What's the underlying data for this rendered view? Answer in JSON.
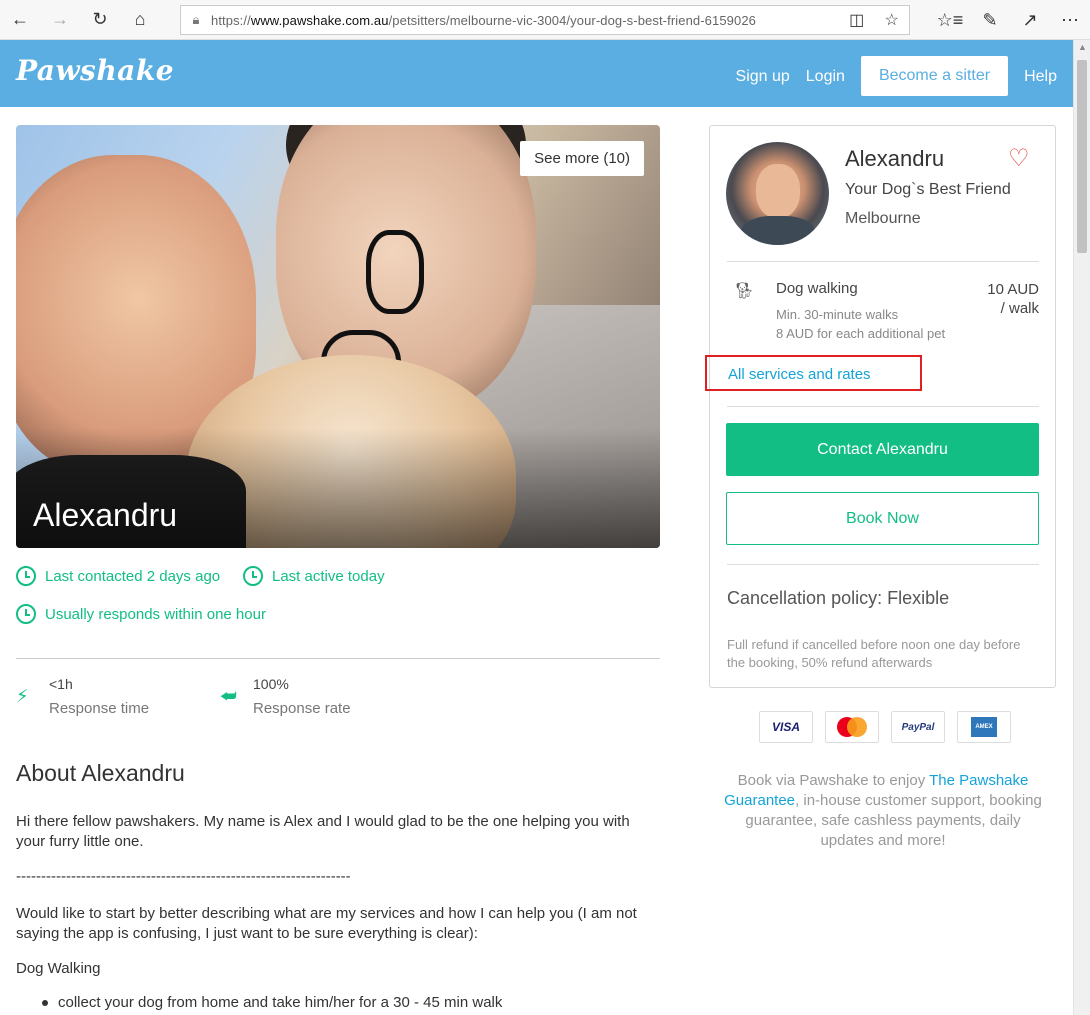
{
  "browser": {
    "url_prefix": "https://",
    "url_domain": "www.pawshake.com.au",
    "url_path": "/petsitters/melbourne-vic-3004/your-dog-s-best-friend-6159026"
  },
  "header": {
    "logo": "Pawshake",
    "signup": "Sign up",
    "login": "Login",
    "become_sitter": "Become a sitter",
    "help": "Help"
  },
  "hero": {
    "see_more": "See more (10)",
    "name": "Alexandru"
  },
  "activity": {
    "last_contacted": "Last contacted 2 days ago",
    "last_active": "Last active today",
    "responds": "Usually responds within one hour"
  },
  "stats": {
    "response_time_value": "<1h",
    "response_time_label": "Response time",
    "response_rate_value": "100%",
    "response_rate_label": "Response rate"
  },
  "about": {
    "title": "About Alexandru",
    "p1": "Hi there fellow pawshakers. My name is Alex and I would glad to be the one helping you with your furry little one.",
    "separator": "-------------------------------------------------------------------",
    "p2": "Would like to start by better describing what are my services and how I can help you (I am not saying the app is confusing, I just want to be sure everything is clear):",
    "p3": "Dog Walking",
    "bullet1": "collect your dog from home and take him/her for a 30 - 45 min walk"
  },
  "card": {
    "name": "Alexandru",
    "tagline": "Your Dog`s Best Friend",
    "city": "Melbourne",
    "service_name": "Dog walking",
    "service_price_line1": "10 AUD",
    "service_price_line2": "/ walk",
    "service_min": "Min. 30-minute walks",
    "service_extra": "8 AUD for each additional pet",
    "all_services": "All services and rates",
    "contact_button": "Contact Alexandru",
    "book_button": "Book Now",
    "policy": "Cancellation policy: Flexible",
    "policy_detail": "Full refund if cancelled before noon one day before the booking, 50% refund afterwards"
  },
  "payments": {
    "visa": "VISA",
    "paypal": "PayPal",
    "amex": "AMEX"
  },
  "guarantee": {
    "before": "Book via Pawshake to enjoy ",
    "link": "The Pawshake Guarantee",
    "after": ", in-house customer support, booking guarantee, safe cashless payments, daily updates and more!"
  },
  "colors": {
    "header_blue": "#5aaee2",
    "accent_green": "#12be84",
    "link_blue": "#14a3d8",
    "highlight_red": "#e02020"
  }
}
